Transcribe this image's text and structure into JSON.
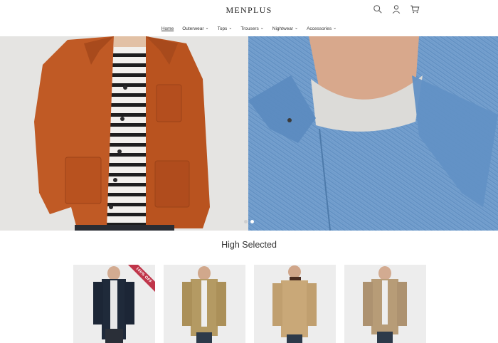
{
  "brand": {
    "logo_text": "MENPLUS"
  },
  "header": {
    "icons": [
      "search-icon",
      "user-icon",
      "cart-icon"
    ]
  },
  "nav": {
    "items": [
      {
        "label": "Home",
        "active": true,
        "has_dropdown": false
      },
      {
        "label": "Outerwear",
        "active": false,
        "has_dropdown": true
      },
      {
        "label": "Tops",
        "active": false,
        "has_dropdown": true
      },
      {
        "label": "Trousers",
        "active": false,
        "has_dropdown": true
      },
      {
        "label": "Nightwear",
        "active": false,
        "has_dropdown": true
      },
      {
        "label": "Accessories",
        "active": false,
        "has_dropdown": true
      }
    ]
  },
  "hero": {
    "slide_count": 2,
    "active_slide": 2
  },
  "section": {
    "title": "High Selected"
  },
  "products": [
    {
      "badge": "100% OFF",
      "jacket_color": "#1f2a3a"
    },
    {
      "badge": "",
      "jacket_color": "#b49a63"
    },
    {
      "badge": "",
      "jacket_color": "#c9a878"
    },
    {
      "badge": "",
      "jacket_color": "#b79c77"
    }
  ],
  "colors": {
    "badge": "#c0354a",
    "hero_left_jacket": "#c05a25",
    "hero_right_denim": "#6f9bcb"
  }
}
